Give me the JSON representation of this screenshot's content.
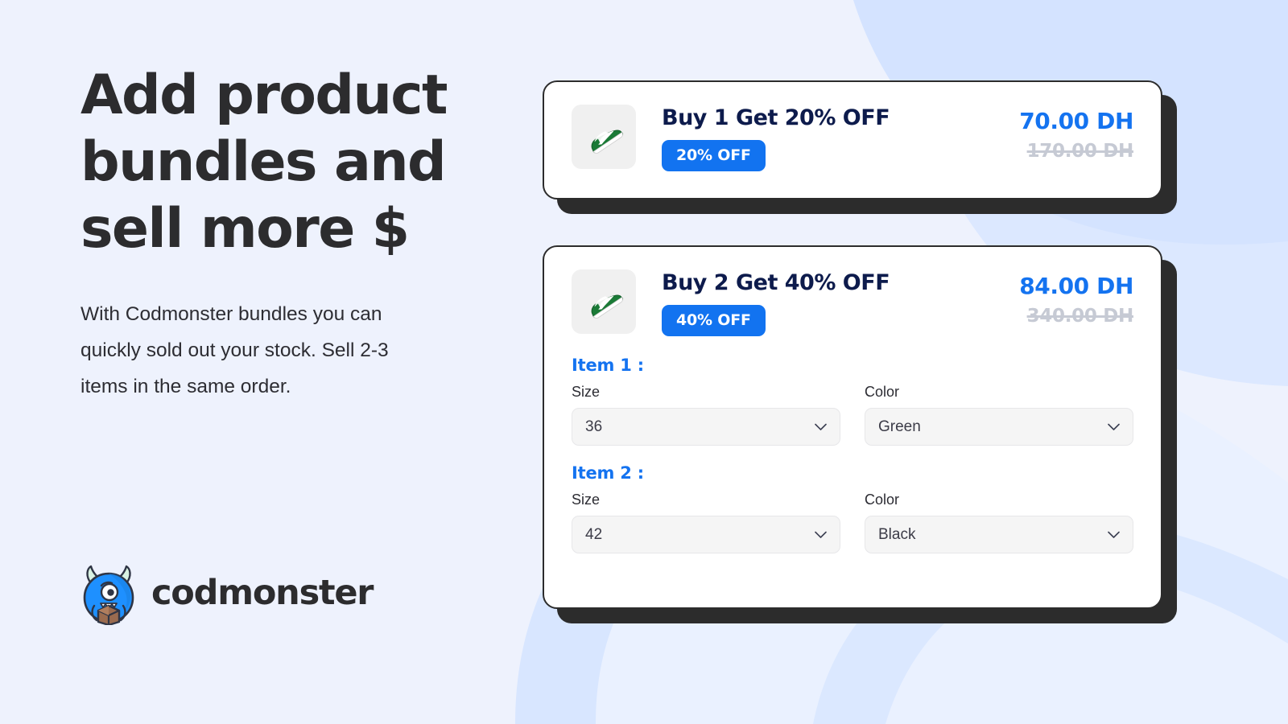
{
  "hero": {
    "headline": "Add product bundles and sell more $",
    "subtext": "With Codmonster bundles you can quickly sold out your stock. Sell 2-3 items in the same order."
  },
  "brand": {
    "name": "codmonster",
    "logo_icon": "codmonster-monster-logo-icon"
  },
  "theme": {
    "page_background": "#eef2fd",
    "decor_blue": "#d6e4ff",
    "accent_blue": "#1473f0",
    "badge_blue": "#1273f0",
    "title_navy": "#0d1b4c",
    "card_border": "#2c2c2c",
    "old_price_gray": "#c6cad4",
    "field_background": "#f5f5f5"
  },
  "bundles": [
    {
      "id": "bundle-1",
      "title": "Buy 1 Get 20% OFF",
      "badge": "20% OFF",
      "price_new": "70.00 DH",
      "price_old": "170.00 DH",
      "thumbnail_icon": "green-sneaker-icon",
      "items": []
    },
    {
      "id": "bundle-2",
      "title": "Buy 2 Get 40% OFF",
      "badge": "40% OFF",
      "price_new": "84.00 DH",
      "price_old": "340.00 DH",
      "thumbnail_icon": "green-sneaker-icon",
      "items": [
        {
          "label": "Item 1 :",
          "fields": [
            {
              "label": "Size",
              "value": "36"
            },
            {
              "label": "Color",
              "value": "Green"
            }
          ]
        },
        {
          "label": "Item 2 :",
          "fields": [
            {
              "label": "Size",
              "value": "42"
            },
            {
              "label": "Color",
              "value": "Black"
            }
          ]
        }
      ]
    }
  ]
}
